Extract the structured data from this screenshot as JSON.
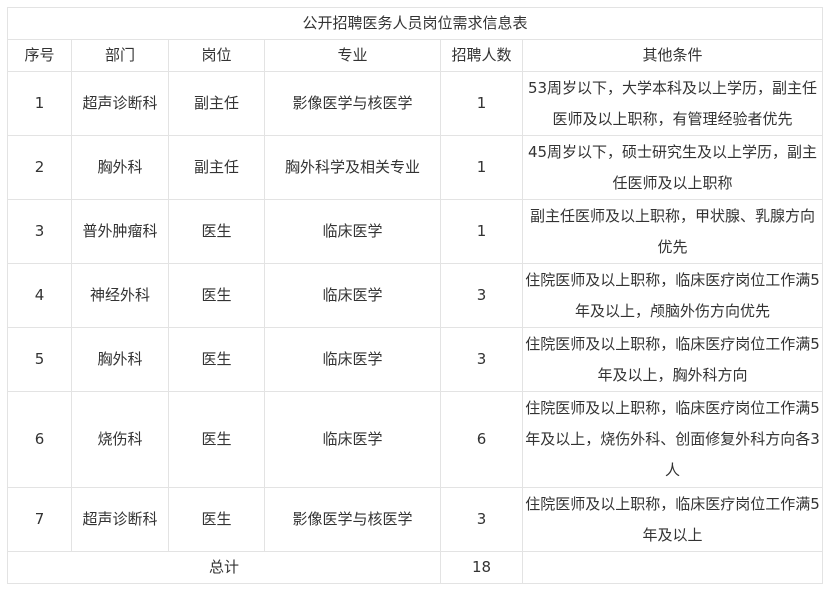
{
  "table": {
    "title": "公开招聘医务人员岗位需求信息表",
    "headers": [
      "序号",
      "部门",
      "岗位",
      "专业",
      "招聘人数",
      "其他条件"
    ],
    "rows": [
      {
        "no": "1",
        "dept": "超声诊断科",
        "post": "副主任",
        "major": "影像医学与核医学",
        "count": "1",
        "cond": "53周岁以下，大学本科及以上学历，副主任医师及以上职称，有管理经验者优先"
      },
      {
        "no": "2",
        "dept": "胸外科",
        "post": "副主任",
        "major": "胸外科学及相关专业",
        "count": "1",
        "cond": "45周岁以下，硕士研究生及以上学历，副主任医师及以上职称"
      },
      {
        "no": "3",
        "dept": "普外肿瘤科",
        "post": "医生",
        "major": "临床医学",
        "count": "1",
        "cond": "副主任医师及以上职称，甲状腺、乳腺方向优先"
      },
      {
        "no": "4",
        "dept": "神经外科",
        "post": "医生",
        "major": "临床医学",
        "count": "3",
        "cond": "住院医师及以上职称，临床医疗岗位工作满5年及以上，颅脑外伤方向优先"
      },
      {
        "no": "5",
        "dept": "胸外科",
        "post": "医生",
        "major": "临床医学",
        "count": "3",
        "cond": "住院医师及以上职称，临床医疗岗位工作满5年及以上，胸外科方向"
      },
      {
        "no": "6",
        "dept": "烧伤科",
        "post": "医生",
        "major": "临床医学",
        "count": "6",
        "cond": "住院医师及以上职称，临床医疗岗位工作满5年及以上，烧伤外科、创面修复外科方向各3人"
      },
      {
        "no": "7",
        "dept": "超声诊断科",
        "post": "医生",
        "major": "影像医学与核医学",
        "count": "3",
        "cond": "住院医师及以上职称，临床医疗岗位工作满5年及以上"
      }
    ],
    "total_label": "总计",
    "total_count": "18"
  }
}
